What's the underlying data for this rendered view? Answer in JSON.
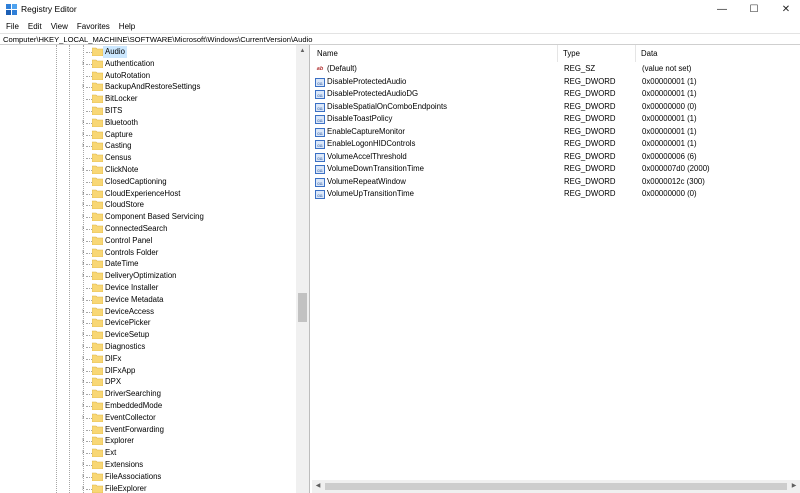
{
  "window": {
    "title": "Registry Editor",
    "icon": "registry-editor-icon",
    "controls": {
      "minimize": "—",
      "maximize": "☐",
      "close": "✕"
    }
  },
  "menu": [
    "File",
    "Edit",
    "View",
    "Favorites",
    "Help"
  ],
  "address": "Computer\\HKEY_LOCAL_MACHINE\\SOFTWARE\\Microsoft\\Windows\\CurrentVersion\\Audio",
  "tree": {
    "items": [
      {
        "label": "Audio",
        "expandable": false,
        "selected": true
      },
      {
        "label": "Authentication",
        "expandable": true
      },
      {
        "label": "AutoRotation",
        "expandable": false
      },
      {
        "label": "BackupAndRestoreSettings",
        "expandable": true
      },
      {
        "label": "BitLocker",
        "expandable": false
      },
      {
        "label": "BITS",
        "expandable": false
      },
      {
        "label": "Bluetooth",
        "expandable": true
      },
      {
        "label": "Capture",
        "expandable": true
      },
      {
        "label": "Casting",
        "expandable": true
      },
      {
        "label": "Census",
        "expandable": false
      },
      {
        "label": "ClickNote",
        "expandable": true
      },
      {
        "label": "ClosedCaptioning",
        "expandable": false
      },
      {
        "label": "CloudExperienceHost",
        "expandable": true
      },
      {
        "label": "CloudStore",
        "expandable": true
      },
      {
        "label": "Component Based Servicing",
        "expandable": true
      },
      {
        "label": "ConnectedSearch",
        "expandable": true
      },
      {
        "label": "Control Panel",
        "expandable": true
      },
      {
        "label": "Controls Folder",
        "expandable": true
      },
      {
        "label": "DateTime",
        "expandable": true
      },
      {
        "label": "DeliveryOptimization",
        "expandable": true
      },
      {
        "label": "Device Installer",
        "expandable": false
      },
      {
        "label": "Device Metadata",
        "expandable": true
      },
      {
        "label": "DeviceAccess",
        "expandable": true
      },
      {
        "label": "DevicePicker",
        "expandable": true
      },
      {
        "label": "DeviceSetup",
        "expandable": true
      },
      {
        "label": "Diagnostics",
        "expandable": true
      },
      {
        "label": "DIFx",
        "expandable": true
      },
      {
        "label": "DIFxApp",
        "expandable": true
      },
      {
        "label": "DPX",
        "expandable": true
      },
      {
        "label": "DriverSearching",
        "expandable": true
      },
      {
        "label": "EmbeddedMode",
        "expandable": true
      },
      {
        "label": "EventCollector",
        "expandable": true
      },
      {
        "label": "EventForwarding",
        "expandable": false
      },
      {
        "label": "Explorer",
        "expandable": true
      },
      {
        "label": "Ext",
        "expandable": true
      },
      {
        "label": "Extensions",
        "expandable": true
      },
      {
        "label": "FileAssociations",
        "expandable": true
      },
      {
        "label": "FileExplorer",
        "expandable": true
      }
    ]
  },
  "values": {
    "columns": {
      "name": "Name",
      "type": "Type",
      "data": "Data"
    },
    "rows": [
      {
        "icon": "string-value-icon",
        "name": "(Default)",
        "type": "REG_SZ",
        "data": "(value not set)"
      },
      {
        "icon": "dword-value-icon",
        "name": "DisableProtectedAudio",
        "type": "REG_DWORD",
        "data": "0x00000001 (1)"
      },
      {
        "icon": "dword-value-icon",
        "name": "DisableProtectedAudioDG",
        "type": "REG_DWORD",
        "data": "0x00000001 (1)"
      },
      {
        "icon": "dword-value-icon",
        "name": "DisableSpatialOnComboEndpoints",
        "type": "REG_DWORD",
        "data": "0x00000000 (0)"
      },
      {
        "icon": "dword-value-icon",
        "name": "DisableToastPolicy",
        "type": "REG_DWORD",
        "data": "0x00000001 (1)"
      },
      {
        "icon": "dword-value-icon",
        "name": "EnableCaptureMonitor",
        "type": "REG_DWORD",
        "data": "0x00000001 (1)"
      },
      {
        "icon": "dword-value-icon",
        "name": "EnableLogonHIDControls",
        "type": "REG_DWORD",
        "data": "0x00000001 (1)"
      },
      {
        "icon": "dword-value-icon",
        "name": "VolumeAccelThreshold",
        "type": "REG_DWORD",
        "data": "0x00000006 (6)"
      },
      {
        "icon": "dword-value-icon",
        "name": "VolumeDownTransitionTime",
        "type": "REG_DWORD",
        "data": "0x000007d0 (2000)"
      },
      {
        "icon": "dword-value-icon",
        "name": "VolumeRepeatWindow",
        "type": "REG_DWORD",
        "data": "0x0000012c (300)"
      },
      {
        "icon": "dword-value-icon",
        "name": "VolumeUpTransitionTime",
        "type": "REG_DWORD",
        "data": "0x00000000 (0)"
      }
    ]
  },
  "colors": {
    "selection": "#cce8ff",
    "folder": "#f8d775",
    "folder_edge": "#dcb143"
  }
}
